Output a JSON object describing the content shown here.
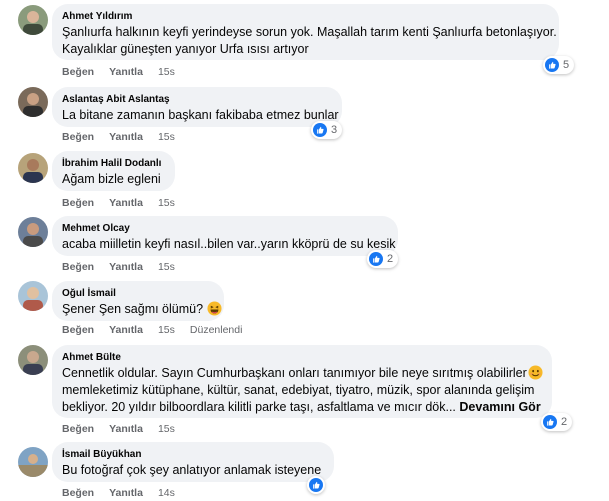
{
  "colors": {
    "bubble": "#f0f2f5",
    "like": "#1877f2",
    "muted": "#65676b"
  },
  "comments": [
    {
      "author": "Ahmet Yıldırım",
      "lines": [
        "Şanlıurfa halkının keyfi yerindeyse sorun yok. Maşallah tarım kenti Şanlıurfa betonlaşıyor.",
        "Kayalıklar güneşten yanıyor Urfa ısısı artıyor"
      ],
      "like_label": "Beğen",
      "reply_label": "Yanıtla",
      "time": "15s",
      "reaction_count": "5"
    },
    {
      "author": "Aslantaş Abit Aslantaş",
      "lines": [
        "La bitane zamanın başkanı fakibaba etmez bunlar"
      ],
      "like_label": "Beğen",
      "reply_label": "Yanıtla",
      "time": "15s",
      "reaction_count": "3"
    },
    {
      "author": "İbrahim Halil Dodanlı",
      "lines": [
        "Ağam bizle egleni"
      ],
      "like_label": "Beğen",
      "reply_label": "Yanıtla",
      "time": "15s"
    },
    {
      "author": "Mehmet Olcay",
      "lines": [
        "acaba miilletin keyfi nasıl..bilen var..yarın kköprü de su kesik"
      ],
      "like_label": "Beğen",
      "reply_label": "Yanıtla",
      "time": "15s",
      "reaction_count": "2"
    },
    {
      "author": "Oğul İsmail",
      "lines": [
        "Şener Şen sağmı ölümü?"
      ],
      "emoji": "laughing-emoji",
      "like_label": "Beğen",
      "reply_label": "Yanıtla",
      "time": "15s",
      "edited_label": "Düzenlendi"
    },
    {
      "author": "Ahmet Bülte",
      "lines": [
        "Cennetlik oldular. Sayın Cumhurbaşkanı onları tanımıyor bile neye sırıtmış olabilirler",
        "memleketimiz kütüphane, kültür, sanat, edebiyat, tiyatro, müzik, spor alanında gelişim",
        "bekliyor. 20 yıldır bilboordlara kilitli parke taşı, asfaltlama ve mıcır dök..."
      ],
      "emoji": "smiling-emoji",
      "see_more": "Devamını Gör",
      "like_label": "Beğen",
      "reply_label": "Yanıtla",
      "time": "15s",
      "reaction_count": "2"
    },
    {
      "author": "İsmail Büyükhan",
      "lines": [
        "Bu fotoğraf çok şey anlatıyor anlamak isteyene"
      ],
      "like_label": "Beğen",
      "reply_label": "Yanıtla",
      "time": "14s",
      "reaction_count": ""
    }
  ]
}
